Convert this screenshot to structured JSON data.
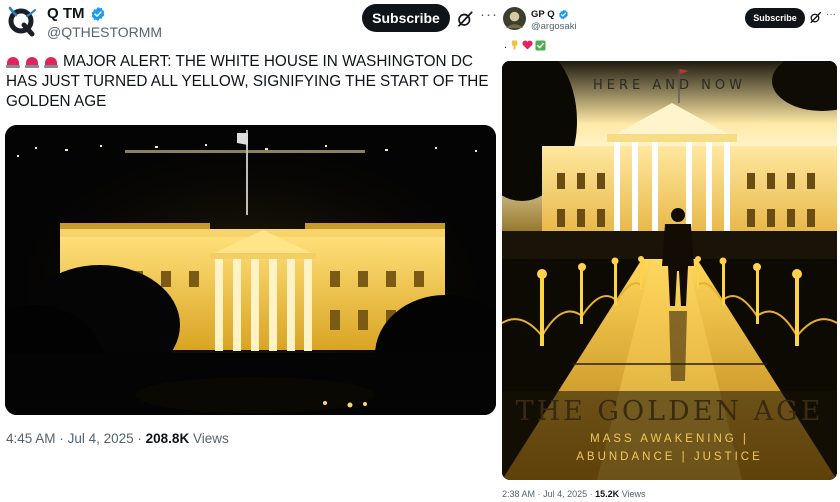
{
  "left_tweet": {
    "author_name": "Q TM",
    "handle": "@QTHESTORMM",
    "subscribe_label": "Subscribe",
    "more_label": "···",
    "text": "MAJOR ALERT: THE WHITE HOUSE IN WASHINGTON DC HAS JUST TURNED ALL YELLOW, SIGNIFYING THE START OF THE GOLDEN AGE",
    "time": "4:45 AM",
    "date": "Jul 4, 2025",
    "views_count": "208.8K",
    "views_label": "Views",
    "avatar_letter": "Q"
  },
  "right_tweet": {
    "author_name": "GP Q",
    "handle": "@argosaki",
    "subscribe_label": "Subscribe",
    "more_label": "···",
    "text_prefix": ".",
    "time": "2:38 AM",
    "date": "Jul 4, 2025",
    "views_count": "15.2K",
    "views_label": "Views",
    "image_text": {
      "top": "HERE AND NOW",
      "title": "THE GOLDEN AGE",
      "line1": "MASS AWAKENING |",
      "line2": "ABUNDANCE | JUSTICE"
    }
  },
  "sep": "·",
  "colors": {
    "verified": "#1d9bf0",
    "subscribe_bg": "#0f1419",
    "text_secondary": "#536471",
    "gold": "#f4c84a"
  }
}
